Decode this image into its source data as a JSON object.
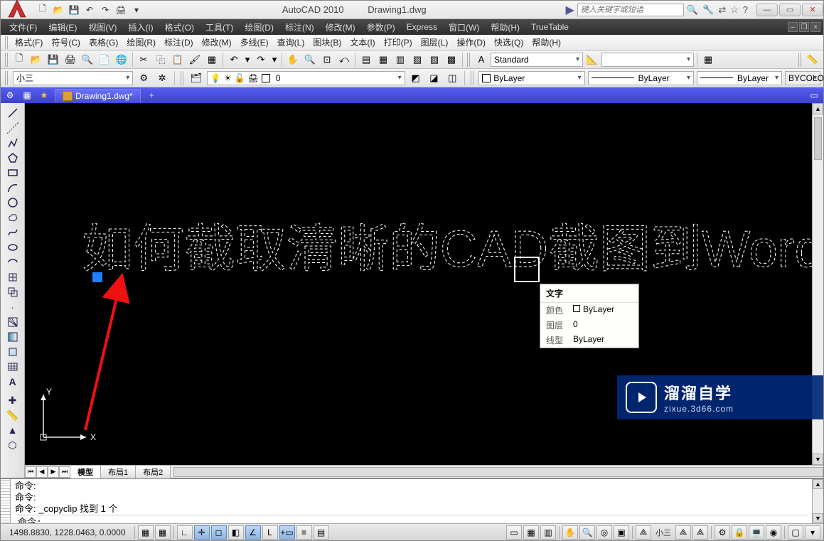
{
  "app": {
    "name": "AutoCAD 2010",
    "doc": "Drawing1.dwg"
  },
  "search": {
    "placeholder": "键入关键字或短语"
  },
  "menu": {
    "file": "文件(F)",
    "edit": "编辑(E)",
    "view": "视图(V)",
    "insert": "插入(I)",
    "format": "格式(O)",
    "tools": "工具(T)",
    "draw": "绘图(D)",
    "dimension": "标注(N)",
    "modify": "修改(M)",
    "param": "参数(P)",
    "express": "Express",
    "window": "窗口(W)",
    "help": "帮助(H)",
    "truetable": "TrueTable"
  },
  "menu2": {
    "format": "格式(F)",
    "symbol": "符号(C)",
    "table": "表格(G)",
    "draw": "绘图(R)",
    "dim": "标注(D)",
    "modify": "修改(M)",
    "mline": "多线(E)",
    "query": "查询(L)",
    "block": "图块(B)",
    "text": "文本(I)",
    "print": "打印(P)",
    "layer": "图层(L)",
    "operate": "操作(D)",
    "qselect": "快选(Q)",
    "help": "帮助(H)"
  },
  "style_combo": "Standard",
  "textsize_combo": "小三",
  "layer_combo": "0",
  "color_combo": "ByLayer",
  "linetype_combo": "ByLayer",
  "lineweight_combo": "ByLayer",
  "plotstyle": "BYCOLOR",
  "tabs": {
    "current": "Drawing1.dwg*"
  },
  "layout": {
    "model": "模型",
    "layout1": "布局1",
    "layout2": "布局2"
  },
  "canvas_text": "如何截取清晰的CAD截图到Word",
  "ucs": {
    "x": "X",
    "y": "Y"
  },
  "tooltip": {
    "title": "文字",
    "color_k": "颜色",
    "color_v": "ByLayer",
    "layer_k": "图层",
    "layer_v": "0",
    "ltype_k": "线型",
    "ltype_v": "ByLayer"
  },
  "cmd": {
    "l1": "命令:",
    "l2": "命令:",
    "l3": "命令: _copyclip 找到 1 个",
    "prompt": "命令:"
  },
  "status": {
    "coords": "1498.8830, 1228.0463, 0.0000",
    "annoscale": "小三"
  },
  "watermark": {
    "big": "溜溜自学",
    "small": "zixue.3d66.com"
  }
}
